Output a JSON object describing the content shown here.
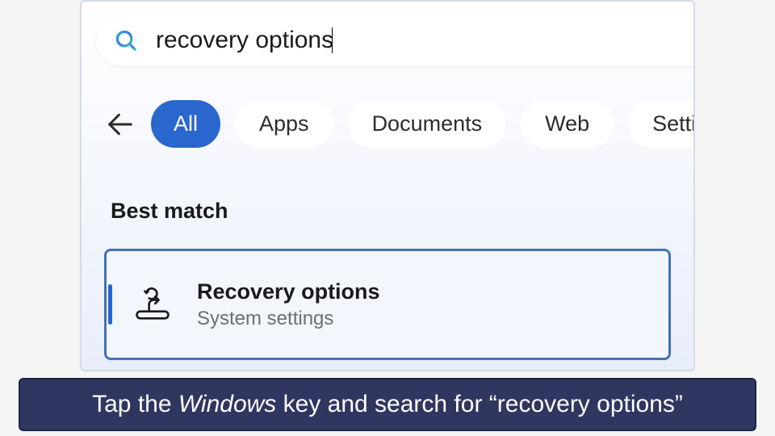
{
  "search": {
    "query": "recovery options"
  },
  "filters": {
    "items": [
      {
        "label": "All",
        "active": true
      },
      {
        "label": "Apps",
        "active": false
      },
      {
        "label": "Documents",
        "active": false
      },
      {
        "label": "Web",
        "active": false
      },
      {
        "label": "Settings",
        "active": false
      }
    ]
  },
  "section": {
    "heading": "Best match"
  },
  "result": {
    "title": "Recovery options",
    "subtitle": "System settings"
  },
  "caption": {
    "prefix": "Tap the ",
    "emphasis": "Windows",
    "suffix": " key and search for “recovery options”"
  },
  "colors": {
    "accent": "#2966cd",
    "banner": "#2f3660"
  }
}
